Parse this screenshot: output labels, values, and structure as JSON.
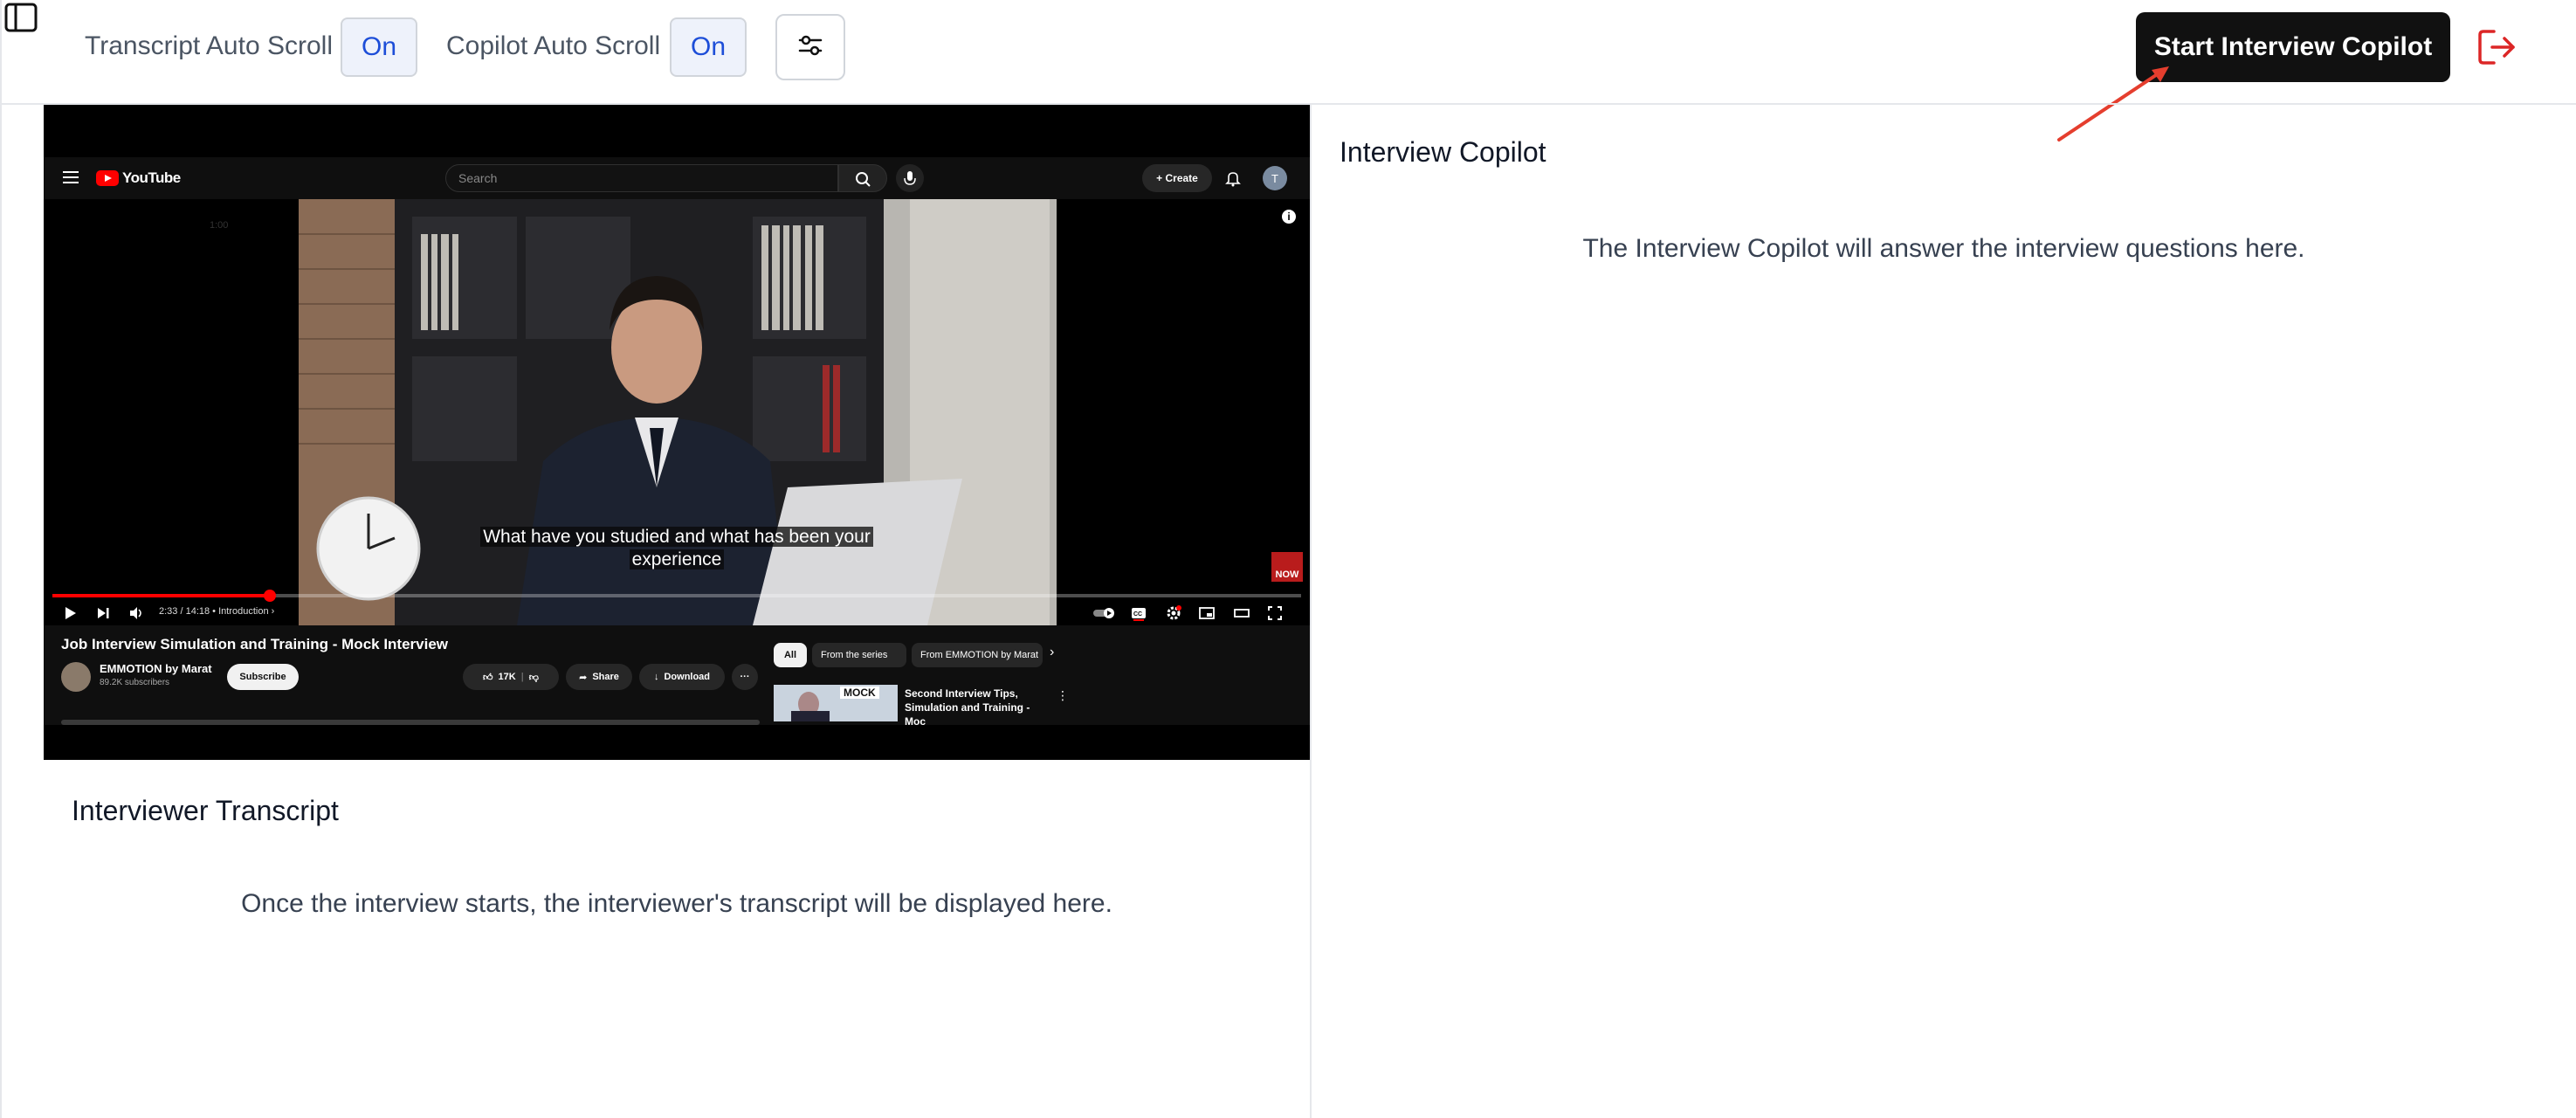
{
  "toolbar": {
    "transcript_auto_scroll_label": "Transcript Auto Scroll",
    "transcript_auto_scroll_value": "On",
    "copilot_auto_scroll_label": "Copilot Auto Scroll",
    "copilot_auto_scroll_value": "On",
    "start_button_label": "Start Interview Copilot"
  },
  "colors": {
    "accent_blue": "#1d4ed8",
    "toggle_bg": "#eef2fb",
    "start_button_bg": "#111111",
    "logout_icon": "#dc2626",
    "annotation_arrow": "#e53e2e"
  },
  "icons": {
    "sidebar_toggle": "sidebar-icon",
    "settings": "sliders-icon",
    "logout": "logout-icon"
  },
  "youtube": {
    "search_placeholder": "Search",
    "create_label": "Create",
    "avatar_initial": "T",
    "player_timecode": "1:00",
    "caption_line1": "What have you studied and what has been your",
    "caption_line2": "experience",
    "now_badge": "NOW",
    "progress": 0.174,
    "time": "2:33 / 14:18",
    "chapter": "Introduction",
    "video_title": "Job Interview Simulation and Training - Mock Interview",
    "channel_name": "EMMOTION by Marat",
    "channel_subscribers": "89.2K subscribers",
    "subscribe_label": "Subscribe",
    "likes": "17K",
    "share_label": "Share",
    "download_label": "Download",
    "chips": [
      "All",
      "From the series",
      "From EMMOTION by Marat"
    ],
    "rec_thumb_label": "MOCK",
    "rec_title": "Second Interview Tips, Simulation and Training - Moc"
  },
  "transcript": {
    "heading": "Interviewer Transcript",
    "placeholder": "Once the interview starts, the interviewer's transcript will be displayed here."
  },
  "copilot": {
    "heading": "Interview Copilot",
    "placeholder": "The Interview Copilot will answer the interview questions here."
  }
}
